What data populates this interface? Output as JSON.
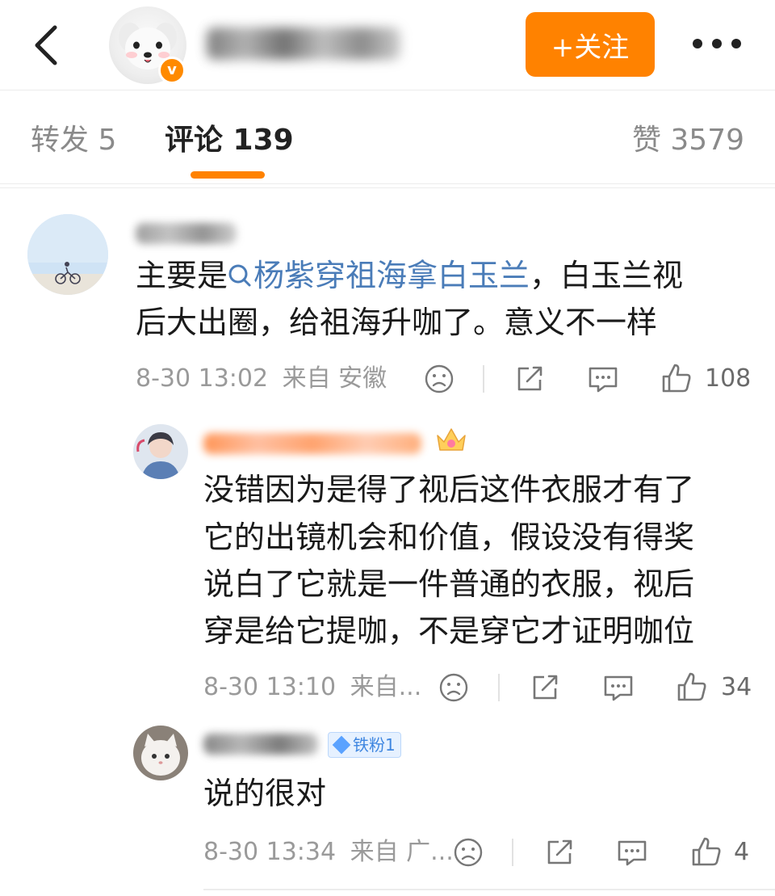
{
  "header": {
    "follow_label": "+关注",
    "badge_letter": "v",
    "colors": {
      "accent": "#ff8200",
      "link": "#4a7cb8"
    }
  },
  "tabs": {
    "repost": "转发 5",
    "comments": "评论 139",
    "likes": "赞 3579"
  },
  "comments": [
    {
      "text_prefix": "主要是",
      "hashtag": "杨紫穿祖海拿白玉兰",
      "text_suffix": "，白玉兰视",
      "text_line2": "后大出圈，给祖海升咖了。意义不一样",
      "time": "8-30 13:02",
      "source": "来自 安徽",
      "likes": "108"
    }
  ],
  "replies": [
    {
      "lines": [
        "没错因为是得了视后这件衣服才有了",
        "它的出镜机会和价值，假设没有得奖",
        "说白了它就是一件普通的衣服，视后",
        "穿是给它提咖，不是穿它才证明咖位"
      ],
      "time": "8-30 13:10",
      "source": "来自...",
      "likes": "34"
    },
    {
      "badge": "铁粉1",
      "lines": [
        "说的很对"
      ],
      "time": "8-30 13:34",
      "source": "来自 广...",
      "likes": "4"
    }
  ]
}
